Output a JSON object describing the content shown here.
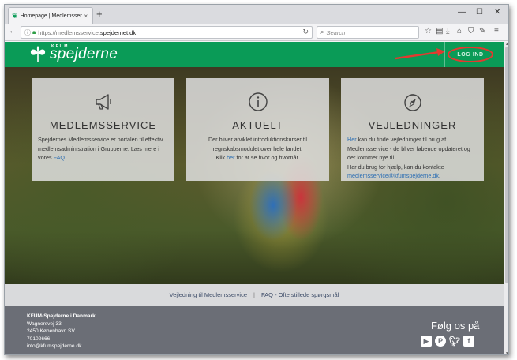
{
  "browser": {
    "tab_title": "Homepage | Medlemsservic",
    "tab_close": "×",
    "new_tab": "+",
    "url_prefix": "https://medlemsservice.",
    "url_host": "spejdernet.dk",
    "search_placeholder": "Search"
  },
  "header": {
    "logo_small": "KFUM",
    "logo_text": "spejderne",
    "login_label": "LOG IND",
    "accent_color": "#0a9b57",
    "highlight_color": "#e23a30"
  },
  "cards": [
    {
      "icon": "megaphone-icon",
      "title": "MEDLEMSSERVICE",
      "body_before": "Spejdernes Medlemsservice er portalen til effektiv medlemsadministration i Grupperne. Læs mere i vores ",
      "link": "FAQ",
      "body_after": "."
    },
    {
      "icon": "info-icon",
      "title": "AKTUELT",
      "line1": "Der bliver afviklet introduktionskurser til regnskabsmodulet over hele landet.",
      "line2_before": "Klik ",
      "link": "her",
      "line2_after": " for at se hvor og hvornår."
    },
    {
      "icon": "compass-icon",
      "title": "VEJLEDNINGER",
      "link": "Her",
      "line1_after": " kan du finde vejledninger til brug af Medlemsservice - de bliver løbende opdateret og der kommer nye til.",
      "line2": "Har du brug for hjælp, kan du kontakte ",
      "email": "medlemsservice@kfumspejderne.dk",
      "line2_after": "."
    }
  ],
  "linkbar": {
    "link1": "Vejledning til Medlemsservice",
    "separator": "|",
    "link2": "FAQ - Ofte stillede spørgsmål"
  },
  "footer": {
    "org": "KFUM-Spejderne i Danmark",
    "street": "Wagnersvej 33",
    "city": "2450 København SV",
    "phone": "70102666",
    "email": "info@kfumspejderne.dk",
    "follow": "Følg os på",
    "social_icons": [
      "youtube-icon",
      "pinterest-icon",
      "twitter-icon",
      "facebook-icon"
    ]
  }
}
